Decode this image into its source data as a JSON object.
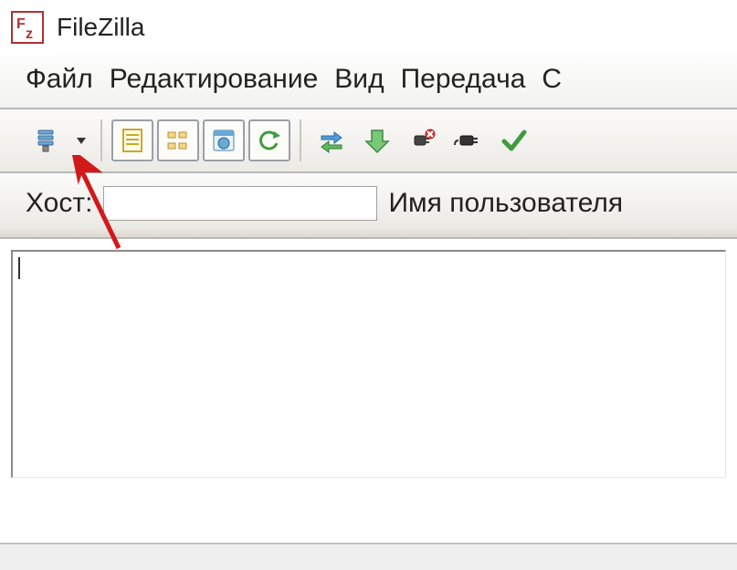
{
  "window": {
    "title": "FileZilla"
  },
  "menubar": {
    "items": [
      "Файл",
      "Редактирование",
      "Вид",
      "Передача",
      "С"
    ]
  },
  "toolbar": {
    "site_manager_tooltip": "Site Manager",
    "site_manager_dropdown_tooltip": "Dropdown"
  },
  "quickconnect": {
    "host_label": "Хост:",
    "host_value": "",
    "username_label": "Имя пользователя"
  },
  "log": {
    "content": ""
  }
}
